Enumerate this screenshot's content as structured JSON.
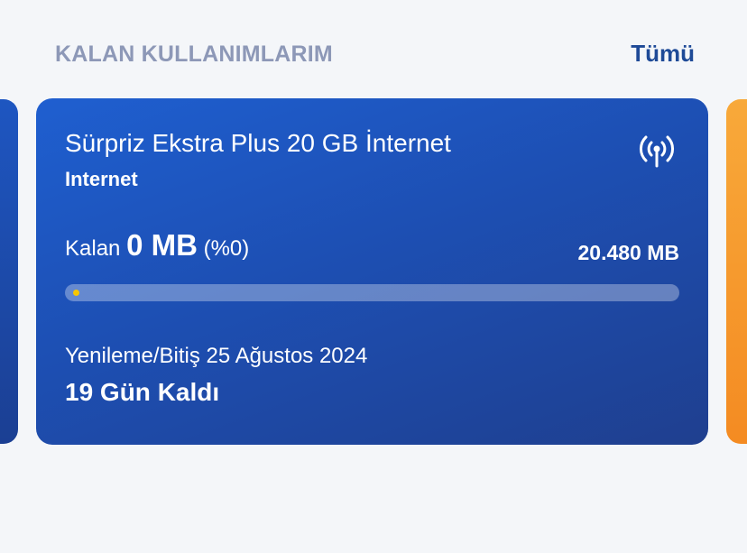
{
  "section": {
    "title": "KALAN KULLANIMLARIM",
    "see_all": "Tümü"
  },
  "card": {
    "plan_name": "Sürpriz Ekstra Plus 20 GB İnternet",
    "plan_type": "Internet",
    "icon": "antenna-signal-icon",
    "remaining_prefix": "Kalan",
    "remaining_value": "0 MB",
    "remaining_percent": "(%0)",
    "total": "20.480 MB",
    "progress_fraction": 0,
    "renewal": "Yenileme/Bitiş 25 Ağustos 2024",
    "days_left": "19 Gün Kaldı"
  },
  "colors": {
    "card_blue": "#1f5fd0",
    "card_blue_dark": "#1f3f8f",
    "accent_orange": "#f48b22",
    "link_blue": "#1e4a97",
    "progress_dot": "#f7c600"
  }
}
